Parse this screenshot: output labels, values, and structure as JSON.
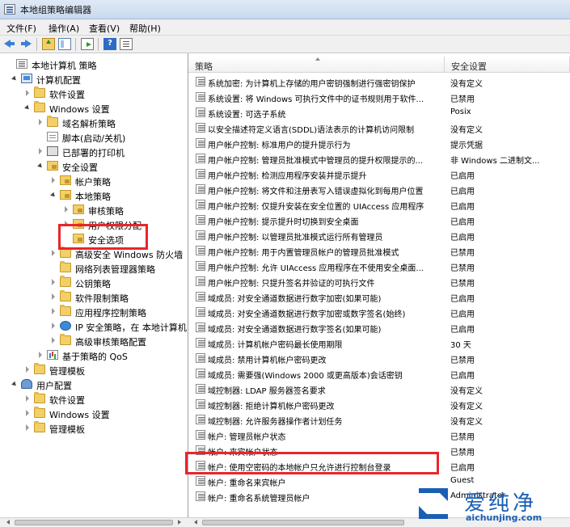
{
  "window": {
    "title": "本地组策略编辑器"
  },
  "menu": [
    "文件(F)",
    "操作(A)",
    "查看(V)",
    "帮助(H)"
  ],
  "tree": [
    {
      "label": "本地计算机 策略",
      "icon": "policy-icon",
      "expander": "none"
    },
    {
      "label": "计算机配置",
      "icon": "computer-icon",
      "expander": "expanded"
    },
    {
      "label": "软件设置",
      "icon": "folder-icon",
      "expander": "collapsed"
    },
    {
      "label": "Windows 设置",
      "icon": "folder-icon",
      "expander": "expanded"
    },
    {
      "label": "域名解析策略",
      "icon": "folder-icon",
      "expander": "collapsed"
    },
    {
      "label": "脚本(启动/关机)",
      "icon": "script-icon",
      "expander": "none"
    },
    {
      "label": "已部署的打印机",
      "icon": "printer-icon",
      "expander": "collapsed"
    },
    {
      "label": "安全设置",
      "icon": "security-icon",
      "expander": "expanded"
    },
    {
      "label": "帐户策略",
      "icon": "lock-folder-icon",
      "expander": "collapsed"
    },
    {
      "label": "本地策略",
      "icon": "lock-folder-icon",
      "expander": "expanded"
    },
    {
      "label": "审核策略",
      "icon": "lock-folder-icon",
      "expander": "collapsed"
    },
    {
      "label": "用户权限分配",
      "icon": "lock-folder-icon",
      "expander": "collapsed"
    },
    {
      "label": "安全选项",
      "icon": "lock-folder-icon",
      "expander": "none"
    },
    {
      "label": "高级安全 Windows 防火墙",
      "icon": "folder-icon",
      "expander": "collapsed"
    },
    {
      "label": "网络列表管理器策略",
      "icon": "folder-icon",
      "expander": "none"
    },
    {
      "label": "公钥策略",
      "icon": "folder-icon",
      "expander": "collapsed"
    },
    {
      "label": "软件限制策略",
      "icon": "folder-icon",
      "expander": "collapsed"
    },
    {
      "label": "应用程序控制策略",
      "icon": "folder-icon",
      "expander": "collapsed"
    },
    {
      "label": "IP 安全策略，在 本地计算机",
      "icon": "ip-security-icon",
      "expander": "collapsed"
    },
    {
      "label": "高级审核策略配置",
      "icon": "folder-icon",
      "expander": "collapsed"
    },
    {
      "label": "基于策略的 QoS",
      "icon": "qos-chart-icon",
      "expander": "collapsed"
    },
    {
      "label": "管理模板",
      "icon": "folder-icon",
      "expander": "collapsed"
    },
    {
      "label": "用户配置",
      "icon": "user-icon",
      "expander": "expanded"
    },
    {
      "label": "软件设置",
      "icon": "folder-icon",
      "expander": "collapsed"
    },
    {
      "label": "Windows 设置",
      "icon": "folder-icon",
      "expander": "collapsed"
    },
    {
      "label": "管理模板",
      "icon": "folder-icon",
      "expander": "collapsed"
    }
  ],
  "columns": {
    "policy": "策略",
    "setting": "安全设置"
  },
  "policies": [
    {
      "name": "系统加密: 为计算机上存储的用户密钥强制进行强密钥保护",
      "value": "没有定义"
    },
    {
      "name": "系统设置: 将 Windows 可执行文件中的证书规则用于软件...",
      "value": "已禁用"
    },
    {
      "name": "系统设置: 可选子系统",
      "value": "Posix"
    },
    {
      "name": "以安全描述符定义语言(SDDL)语法表示的计算机访问限制",
      "value": "没有定义"
    },
    {
      "name": "用户帐户控制: 标准用户的提升提示行为",
      "value": "提示凭据"
    },
    {
      "name": "用户帐户控制: 管理员批准模式中管理员的提升权限提示的...",
      "value": "非 Windows 二进制文..."
    },
    {
      "name": "用户帐户控制: 检测应用程序安装并提示提升",
      "value": "已启用"
    },
    {
      "name": "用户帐户控制: 将文件和注册表写入错误虚拟化到每用户位置",
      "value": "已启用"
    },
    {
      "name": "用户帐户控制: 仅提升安装在安全位置的 UIAccess 应用程序",
      "value": "已启用"
    },
    {
      "name": "用户帐户控制: 提示提升时切换到安全桌面",
      "value": "已启用"
    },
    {
      "name": "用户帐户控制: 以管理员批准模式运行所有管理员",
      "value": "已启用"
    },
    {
      "name": "用户帐户控制: 用于内置管理员帐户的管理员批准模式",
      "value": "已禁用"
    },
    {
      "name": "用户帐户控制: 允许 UIAccess 应用程序在不使用安全桌面...",
      "value": "已禁用"
    },
    {
      "name": "用户帐户控制: 只提升签名并验证的可执行文件",
      "value": "已禁用"
    },
    {
      "name": "域成员: 对安全通道数据进行数字加密(如果可能)",
      "value": "已启用"
    },
    {
      "name": "域成员: 对安全通道数据进行数字加密或数字签名(始终)",
      "value": "已启用"
    },
    {
      "name": "域成员: 对安全通道数据进行数字签名(如果可能)",
      "value": "已启用"
    },
    {
      "name": "域成员: 计算机帐户密码最长使用期限",
      "value": "30 天"
    },
    {
      "name": "域成员: 禁用计算机帐户密码更改",
      "value": "已禁用"
    },
    {
      "name": "域成员: 需要强(Windows 2000 或更高版本)会话密钥",
      "value": "已启用"
    },
    {
      "name": "域控制器: LDAP 服务器签名要求",
      "value": "没有定义"
    },
    {
      "name": "域控制器: 拒绝计算机帐户密码更改",
      "value": "没有定义"
    },
    {
      "name": "域控制器: 允许服务器操作者计划任务",
      "value": "没有定义"
    },
    {
      "name": "帐户: 管理员帐户状态",
      "value": "已禁用"
    },
    {
      "name": "帐户: 来宾帐户状态",
      "value": "已禁用"
    },
    {
      "name": "帐户: 使用空密码的本地帐户只允许进行控制台登录",
      "value": "已启用"
    },
    {
      "name": "帐户: 重命名来宾帐户",
      "value": "Guest"
    },
    {
      "name": "帐户: 重命名系统管理员帐户",
      "value": "Administrator"
    }
  ],
  "watermark": {
    "brand": "爱纯净",
    "url": "aichunjing.com"
  },
  "colors": {
    "highlight": "#e8262a",
    "brand": "#1a5fb4"
  }
}
